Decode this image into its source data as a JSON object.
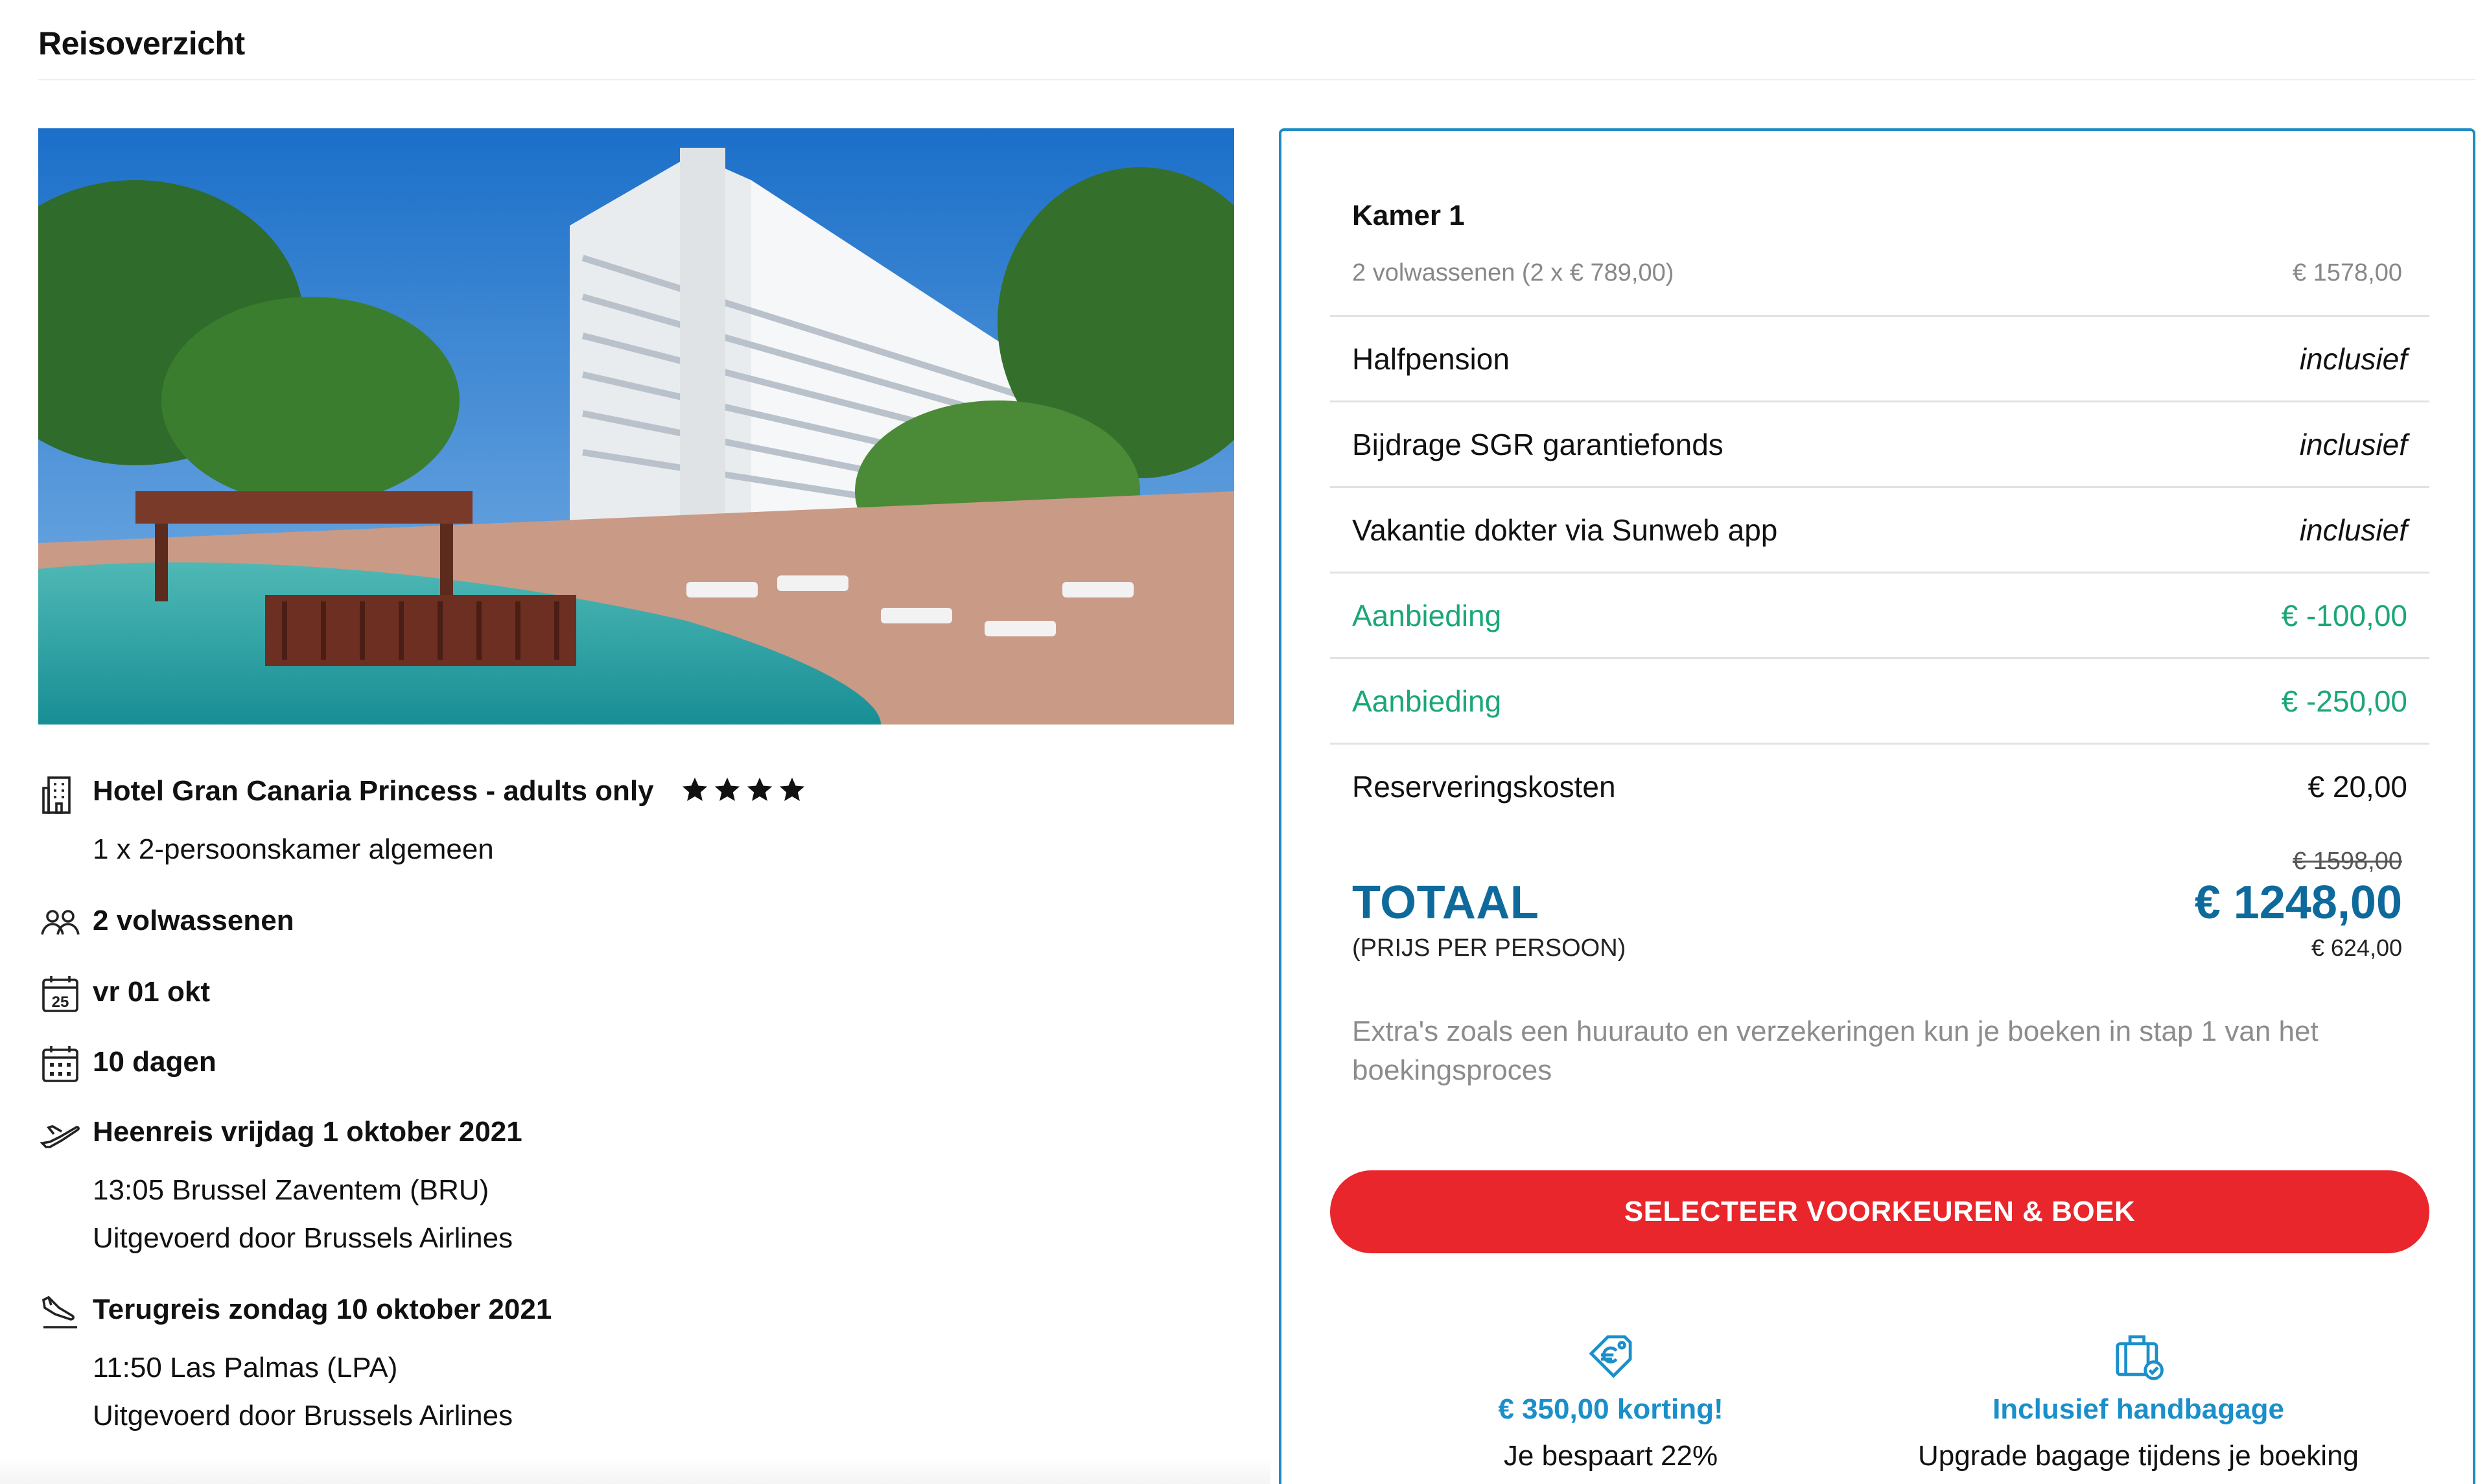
{
  "header": {
    "title": "Reisoverzicht"
  },
  "hotel": {
    "name": "Hotel Gran Canaria Princess - adults only",
    "stars": 4,
    "room": "1 x 2-persoonskamer algemeen",
    "icon": "building-icon"
  },
  "details": {
    "travelers": "2 volwassenen",
    "date": "vr 01 okt",
    "duration": "10 dagen",
    "calendar_day": "25"
  },
  "outbound": {
    "title": "Heenreis vrijdag 1 oktober 2021",
    "departure": "13:05 Brussel Zaventem (BRU)",
    "carrier": "Uitgevoerd door Brussels Airlines"
  },
  "return": {
    "title": "Terugreis zondag 10 oktober 2021",
    "departure": "11:50 Las Palmas (LPA)",
    "carrier": "Uitgevoerd door Brussels Airlines"
  },
  "summary": {
    "room_title": "Kamer 1",
    "adults_label": "2 volwassenen (2 x € 789,00)",
    "adults_price": "€ 1578,00",
    "lines": [
      {
        "label": "Halfpension",
        "value": "inclusief",
        "style": "included"
      },
      {
        "label": "Bijdrage SGR garantiefonds",
        "value": "inclusief",
        "style": "included"
      },
      {
        "label": "Vakantie dokter via Sunweb app",
        "value": "inclusief",
        "style": "included"
      },
      {
        "label": "Aanbieding",
        "value": "€ -100,00",
        "style": "discount"
      },
      {
        "label": "Aanbieding",
        "value": "€ -250,00",
        "style": "discount"
      },
      {
        "label": "Reserveringskosten",
        "value": "€ 20,00",
        "style": "normal"
      }
    ],
    "old_total": "€ 1598,00",
    "total_label": "TOTAAL",
    "total": "€ 1248,00",
    "per_person_label": "(PRIJS PER PERSOON)",
    "per_person": "€ 624,00",
    "extras_note": "Extra's zoals een huurauto en verzekeringen kun je boeken in stap 1 van het boekingsproces",
    "book_button": "SELECTEER VOORKEUREN & BOEK"
  },
  "usps": [
    {
      "icon": "price-tag-icon",
      "title": "€ 350,00 korting!",
      "subtitle": "Je bespaart 22%"
    },
    {
      "icon": "luggage-check-icon",
      "title": "Inclusief handbagage",
      "subtitle": "Upgrade bagage tijdens je boeking"
    }
  ],
  "colors": {
    "accent_blue": "#0f6a9c",
    "link_blue": "#1a8fca",
    "card_border": "#1d8cc4",
    "discount_green": "#1ba776",
    "button_red": "#e8262b"
  }
}
